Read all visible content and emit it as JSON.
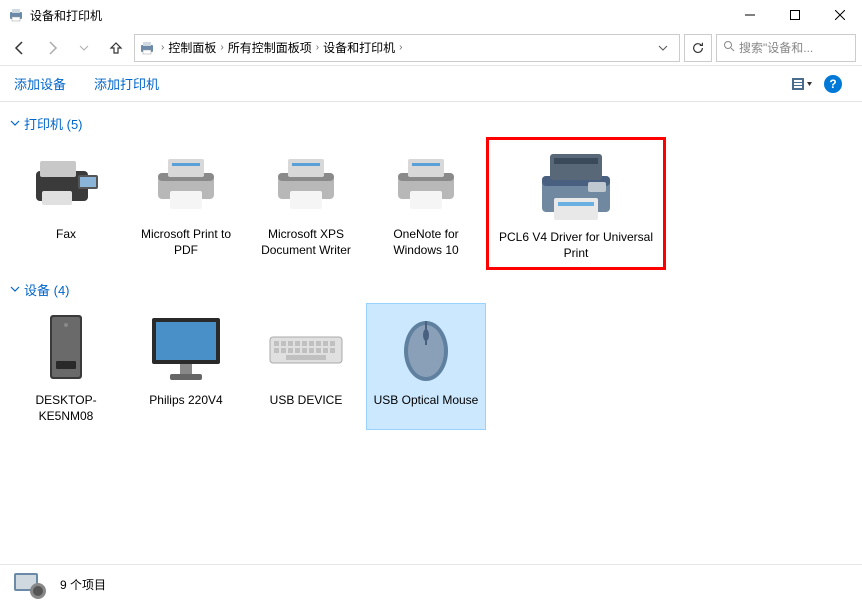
{
  "window": {
    "title": "设备和打印机"
  },
  "nav": {
    "breadcrumbs": [
      "控制面板",
      "所有控制面板项",
      "设备和打印机"
    ]
  },
  "search": {
    "placeholder": "搜索\"设备和..."
  },
  "commands": {
    "add_device": "添加设备",
    "add_printer": "添加打印机"
  },
  "groups": [
    {
      "title": "打印机 (5)",
      "items": [
        {
          "name": "Fax",
          "icon": "fax"
        },
        {
          "name": "Microsoft Print to PDF",
          "icon": "printer"
        },
        {
          "name": "Microsoft XPS Document Writer",
          "icon": "printer"
        },
        {
          "name": "OneNote for Windows 10",
          "icon": "printer"
        },
        {
          "name": "PCL6 V4 Driver for Universal Print",
          "icon": "mfp",
          "highlighted": true
        }
      ]
    },
    {
      "title": "设备 (4)",
      "items": [
        {
          "name": "DESKTOP-KE5NM08",
          "icon": "pc"
        },
        {
          "name": "Philips 220V4",
          "icon": "monitor"
        },
        {
          "name": "USB DEVICE",
          "icon": "keyboard"
        },
        {
          "name": "USB Optical Mouse",
          "icon": "mouse",
          "selected": true
        }
      ]
    }
  ],
  "status": {
    "text": "9 个项目"
  }
}
